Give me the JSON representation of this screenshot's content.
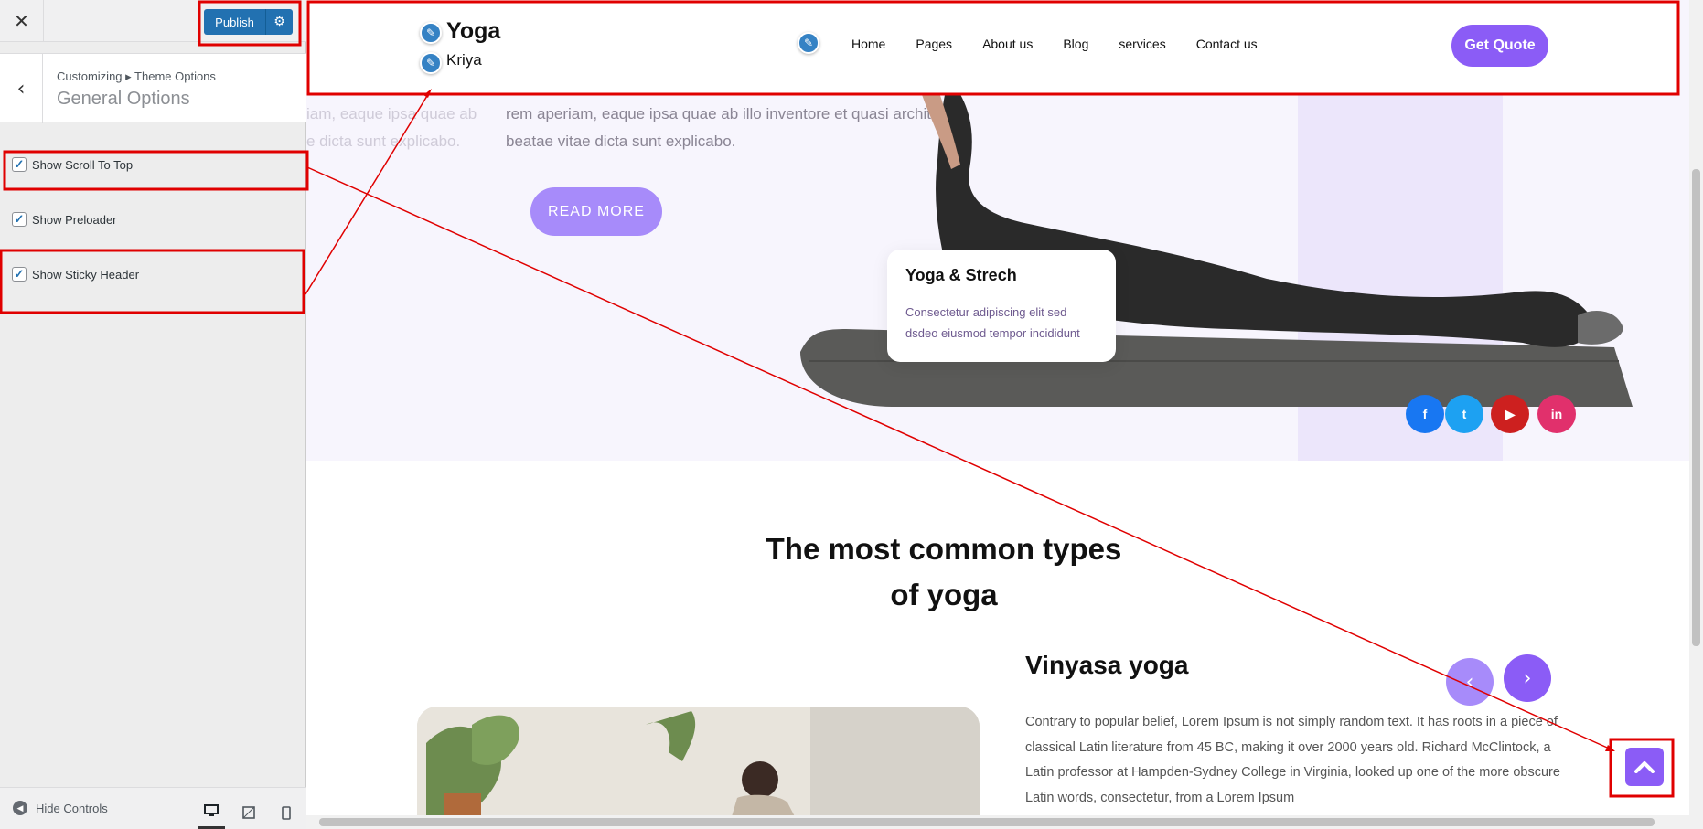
{
  "customizer": {
    "close_label": "✕",
    "publish_label": "Publish",
    "breadcrumb": "Customizing ▸ Theme Options",
    "section_title": "General Options",
    "options": [
      {
        "label": "Show Scroll To Top",
        "checked": true
      },
      {
        "label": "Show Preloader",
        "checked": true
      },
      {
        "label": "Show Sticky Header",
        "checked": true
      }
    ],
    "hide_controls_label": "Hide Controls",
    "devices": [
      "desktop-icon",
      "tablet-icon",
      "mobile-icon"
    ]
  },
  "site": {
    "logo_title": "Yoga",
    "logo_subtitle": "Kriya",
    "nav": [
      "Home",
      "Pages",
      "About us",
      "Blog",
      "services",
      "Contact us"
    ],
    "cta": "Get Quote",
    "hero": {
      "faded_lines": [
        "iam, eaque ipsa quae ab",
        "e dicta sunt explicabo."
      ],
      "lines": [
        "rem aperiam, eaque ipsa quae ab illo inventore et quasi architecto",
        "beatae vitae dicta sunt explicabo."
      ],
      "button": "READ MORE"
    },
    "card": {
      "title": "Yoga & Strech",
      "text": "Consectetur adipiscing elit sed dsdeo eiusmod tempor incididunt"
    },
    "social": [
      {
        "icon": "facebook-icon",
        "glyph": "f",
        "color": "#1877f2"
      },
      {
        "icon": "twitter-icon",
        "glyph": "t",
        "color": "#1da1f2"
      },
      {
        "icon": "youtube-icon",
        "glyph": "▶",
        "color": "#cd201f"
      },
      {
        "icon": "linkedin-icon",
        "glyph": "in",
        "color": "#e1306c"
      }
    ],
    "section_title_line1": "The most common types",
    "section_title_line2": "of yoga",
    "vinyasa_title": "Vinyasa yoga",
    "vinyasa_text": "Contrary to popular belief, Lorem Ipsum is not simply random text. It has roots in a piece of classical Latin literature from 45 BC, making it over 2000 years old. Richard McClintock, a Latin professor at Hampden-Sydney College in Virginia, looked up one of the more obscure Latin words, consectetur, from a Lorem Ipsum"
  },
  "colors": {
    "accent": "#8b5cf6",
    "publish": "#2271b1",
    "annotation": "#e00000"
  }
}
